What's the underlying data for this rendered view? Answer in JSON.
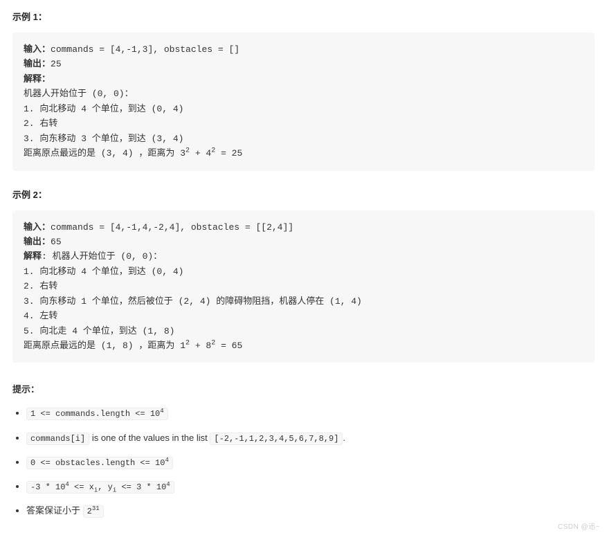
{
  "example1": {
    "title": "示例 1：",
    "input_label": "输入：",
    "input_value": "commands = [4,-1,3], obstacles = []",
    "output_label": "输出：",
    "output_value": "25",
    "explain_label": "解释：",
    "line0": "机器人开始位于 (0, 0)：",
    "line1": "1. 向北移动 4 个单位，到达 (0, 4)",
    "line2": "2. 右转",
    "line3": "3. 向东移动 3 个单位，到达 (3, 4)",
    "dist_prefix": "距离原点最远的是 (3, 4) ，距离为 3",
    "dist_mid": " + 4",
    "dist_suffix": " = 25",
    "sq": "2"
  },
  "example2": {
    "title": "示例 2：",
    "input_label": "输入：",
    "input_value": "commands = [4,-1,4,-2,4], obstacles = [[2,4]]",
    "output_label": "输出：",
    "output_value": "65",
    "explain_label": "解释",
    "explain_rest": ": 机器人开始位于 (0, 0)：",
    "line1": "1. 向北移动 4 个单位，到达 (0, 4)",
    "line2": "2. 右转",
    "line3": "3. 向东移动 1 个单位，然后被位于 (2, 4) 的障碍物阻挡，机器人停在 (1, 4)",
    "line4": "4. 左转",
    "line5": "5. 向北走 4 个单位，到达 (1, 8)",
    "dist_prefix": "距离原点最远的是 (1, 8) ，距离为 1",
    "dist_mid": " + 8",
    "dist_suffix": " = 65",
    "sq": "2"
  },
  "hints": {
    "title": "提示：",
    "li1_pre": "1 <= commands.length <= 10",
    "li1_sup": "4",
    "li2_code1": "commands[i]",
    "li2_text": " is one of the values in the list ",
    "li2_code2": "[-2,-1,1,2,3,4,5,6,7,8,9]",
    "li2_suffix": ".",
    "li3_pre": "0 <= obstacles.length <= 10",
    "li3_sup": "4",
    "li4_pre": "-3 * 10",
    "li4_sup": "4",
    "li4_mid": " <= x",
    "li4_sub1": "i",
    "li4_mid2": ", y",
    "li4_sub2": "i",
    "li4_mid3": " <= 3 * 10",
    "li5_text": "答案保证小于 ",
    "li5_code_pre": "2",
    "li5_code_sup": "31"
  },
  "watermark": "CSDN @迅~"
}
